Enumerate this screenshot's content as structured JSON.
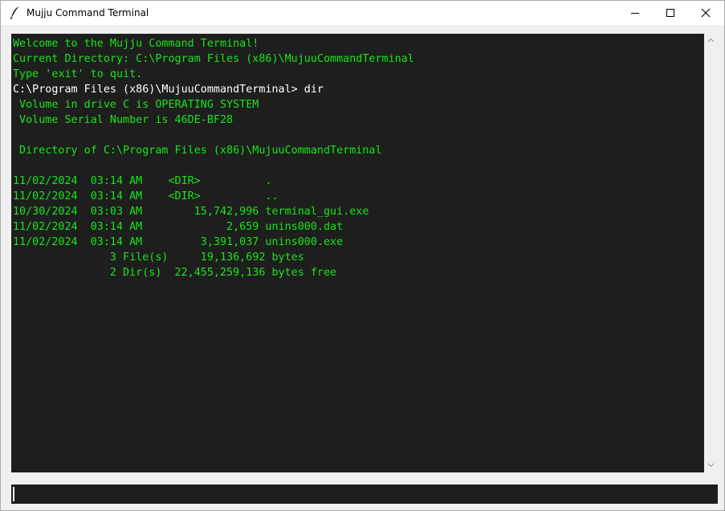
{
  "window": {
    "title": "Mujju Command Terminal",
    "icon": "feather-icon",
    "controls": {
      "minimize": "minimize-icon",
      "maximize": "maximize-icon",
      "close": "close-icon"
    }
  },
  "colors": {
    "output_text": "#17e617",
    "input_text": "#ffffff",
    "terminal_bg": "#1e1e1e"
  },
  "terminal": {
    "lines": [
      {
        "text": "Welcome to the Mujju Command Terminal!",
        "color": "#17e617"
      },
      {
        "text": "Current Directory: C:\\Program Files (x86)\\MujuuCommandTerminal",
        "color": "#17e617"
      },
      {
        "text": "Type 'exit' to quit.",
        "color": "#17e617"
      },
      {
        "text": "C:\\Program Files (x86)\\MujuuCommandTerminal> dir",
        "color": "#ffffff"
      },
      {
        "text": " Volume in drive C is OPERATING SYSTEM",
        "color": "#17e617"
      },
      {
        "text": " Volume Serial Number is 46DE-BF28",
        "color": "#17e617"
      },
      {
        "text": "",
        "color": "#17e617"
      },
      {
        "text": " Directory of C:\\Program Files (x86)\\MujuuCommandTerminal",
        "color": "#17e617"
      },
      {
        "text": "",
        "color": "#17e617"
      },
      {
        "text": "11/02/2024  03:14 AM    <DIR>          .",
        "color": "#17e617"
      },
      {
        "text": "11/02/2024  03:14 AM    <DIR>          ..",
        "color": "#17e617"
      },
      {
        "text": "10/30/2024  03:03 AM        15,742,996 terminal_gui.exe",
        "color": "#17e617"
      },
      {
        "text": "11/02/2024  03:14 AM             2,659 unins000.dat",
        "color": "#17e617"
      },
      {
        "text": "11/02/2024  03:14 AM         3,391,037 unins000.exe",
        "color": "#17e617"
      },
      {
        "text": "               3 File(s)     19,136,692 bytes",
        "color": "#17e617"
      },
      {
        "text": "               2 Dir(s)  22,455,259,136 bytes free",
        "color": "#17e617"
      }
    ]
  },
  "command_input": {
    "value": ""
  }
}
